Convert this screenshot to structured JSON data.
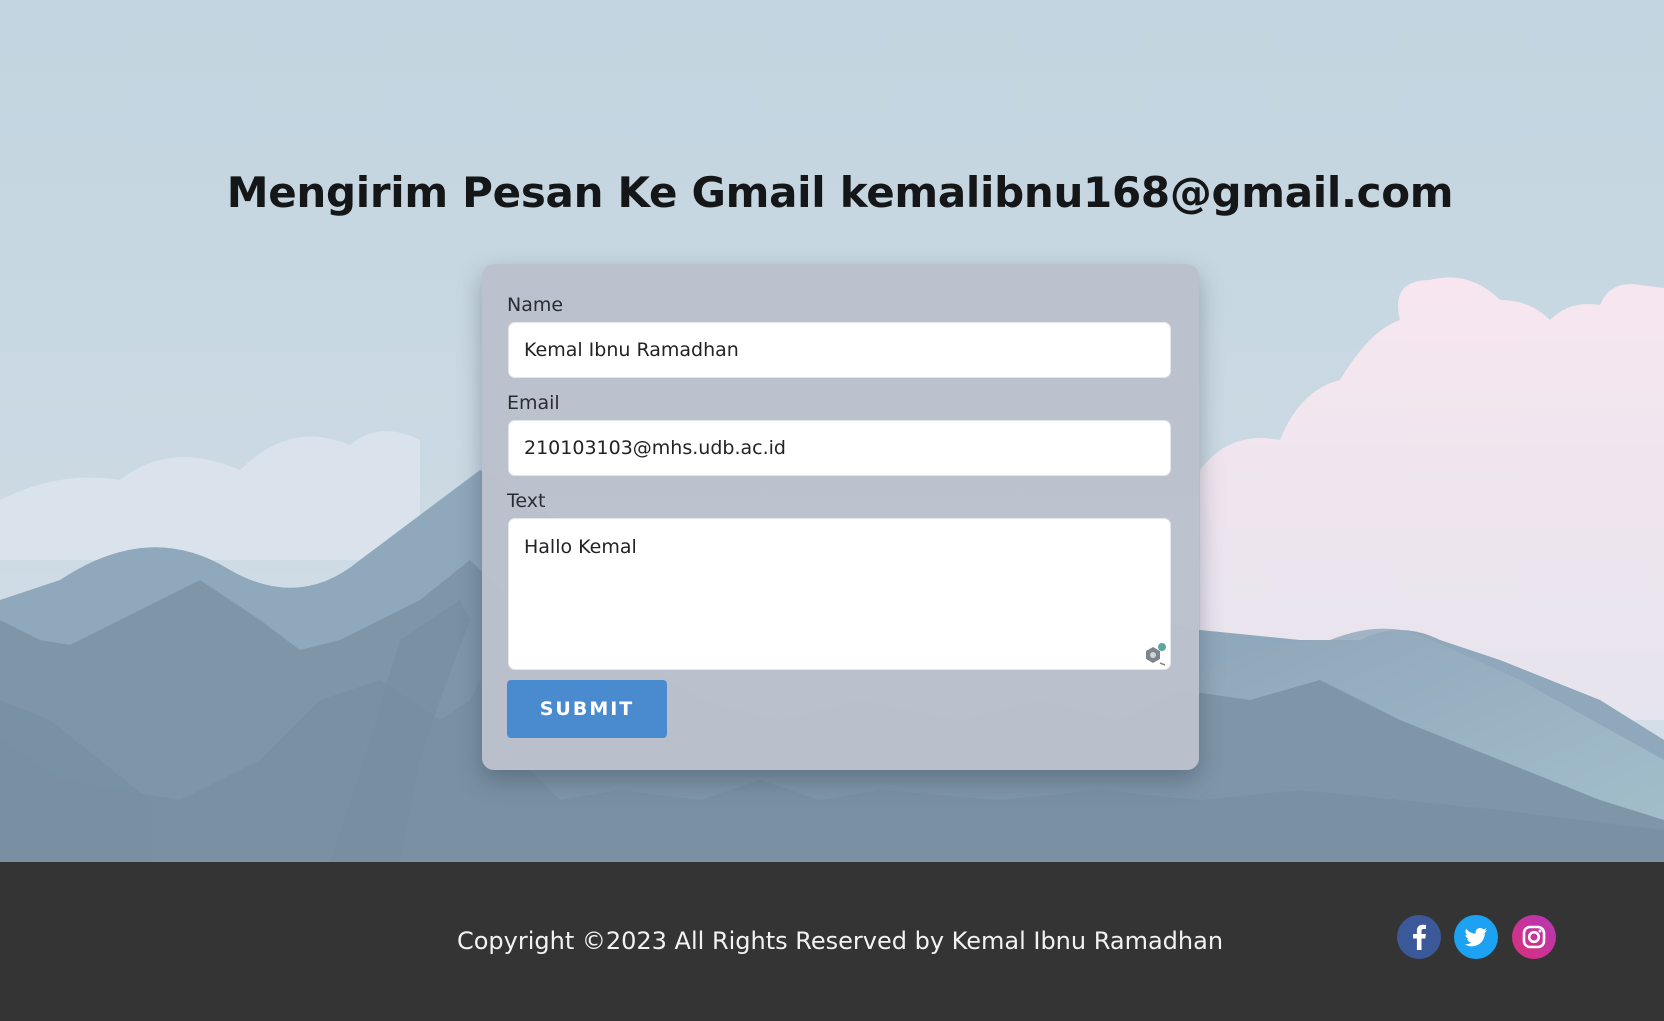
{
  "header": {
    "title": "Mengirim Pesan Ke Gmail kemalibnu168@gmail.com"
  },
  "form": {
    "name_label": "Name",
    "name_value": "Kemal Ibnu Ramadhan",
    "email_label": "Email",
    "email_value": "210103103@mhs.udb.ac.id",
    "text_label": "Text",
    "text_value": "Hallo Kemal",
    "submit_label": "SUBMIT"
  },
  "footer": {
    "copyright": "Copyright ©2023 All Rights Reserved by Kemal Ibnu Ramadhan",
    "social": [
      {
        "name": "facebook",
        "icon": "facebook-icon",
        "color": "#3b5998"
      },
      {
        "name": "twitter",
        "icon": "twitter-icon",
        "color": "#1da1f2"
      },
      {
        "name": "instagram",
        "icon": "instagram-icon",
        "color": "#c13584"
      }
    ]
  },
  "colors": {
    "sky_top": "#c2d5e0",
    "submit_bg": "#4a8bcf",
    "card_bg": "#bbc1cc",
    "footer_bg": "#343434"
  }
}
